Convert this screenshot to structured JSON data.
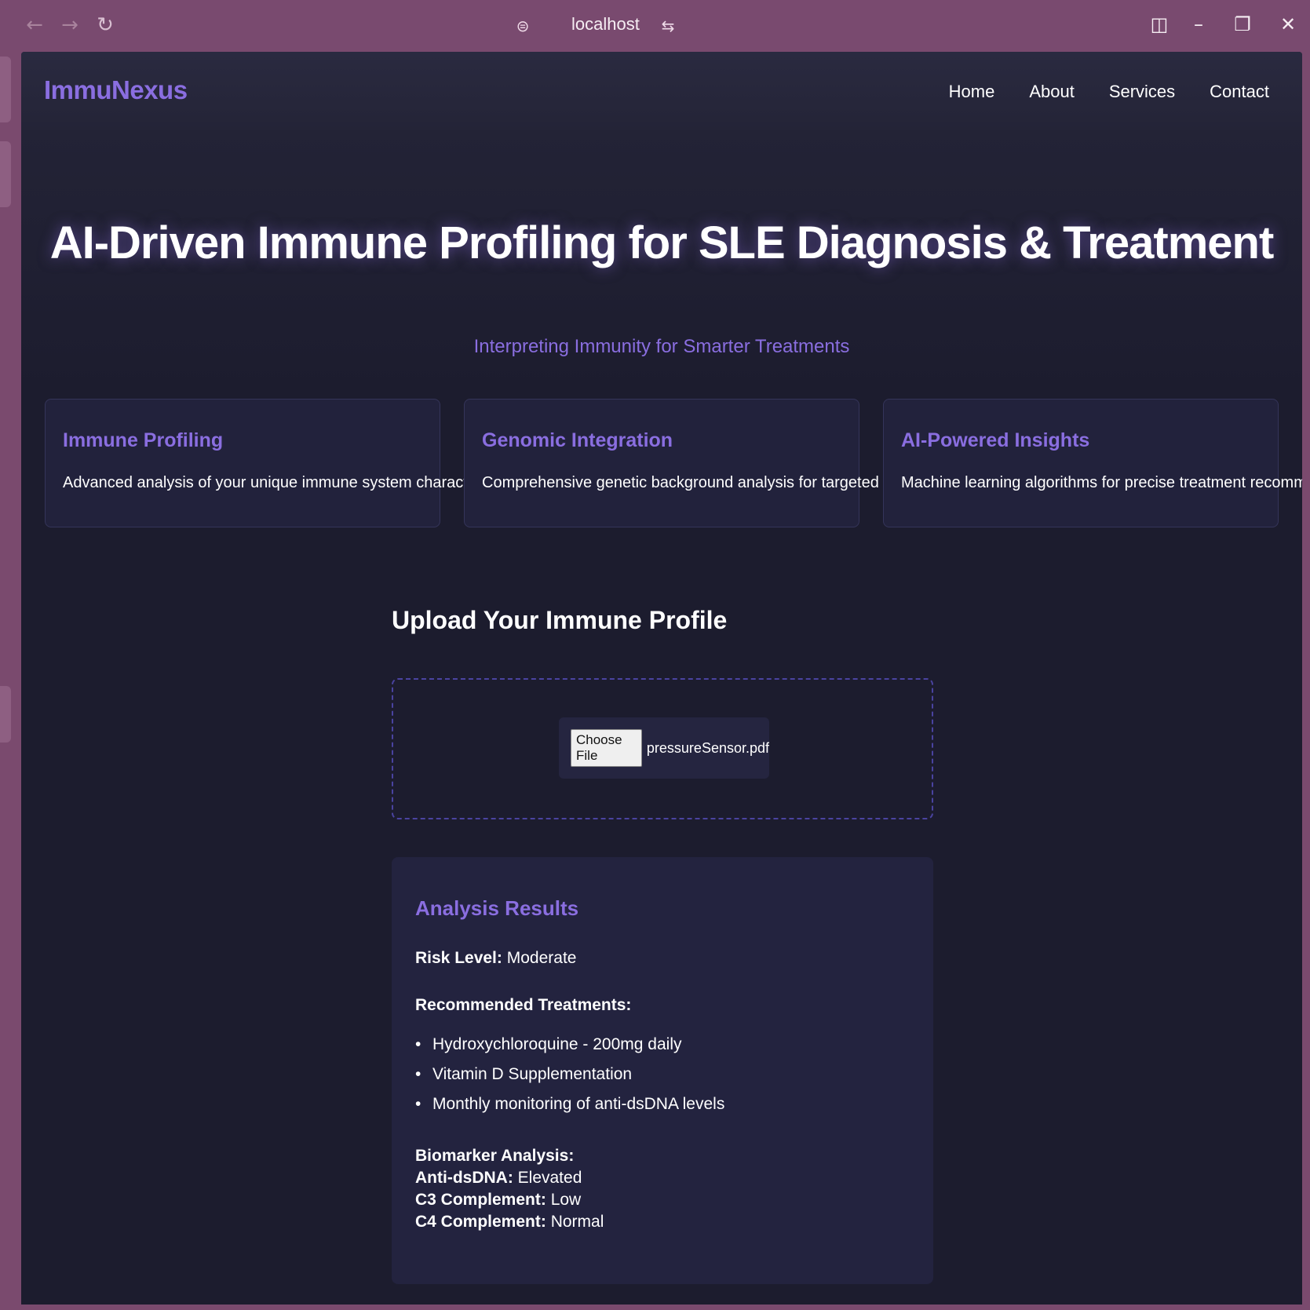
{
  "browser": {
    "url": "localhost",
    "icons": [
      "back-arrow-icon",
      "forward-arrow-icon",
      "reload-icon",
      "site-info-icon",
      "site-settings-icon",
      "sidebar-icon",
      "minimize-icon",
      "restore-icon",
      "close-icon"
    ]
  },
  "header": {
    "logo": "ImmuNexus",
    "nav": [
      "Home",
      "About",
      "Services",
      "Contact"
    ]
  },
  "hero": {
    "title": "AI-Driven Immune Profiling for SLE Diagnosis & Treatment",
    "subtitle": "Interpreting Immunity for Smarter Treatments"
  },
  "features": [
    {
      "title": "Immune Profiling",
      "desc": "Advanced analysis of your unique immune system characteristics"
    },
    {
      "title": "Genomic Integration",
      "desc": "Comprehensive genetic background analysis for targeted treatment"
    },
    {
      "title": "AI-Powered Insights",
      "desc": "Machine learning algorithms for precise treatment recommendations"
    }
  ],
  "upload": {
    "title": "Upload Your Immune Profile",
    "button": "Choose File",
    "file_name": "pressureSensor.pdf"
  },
  "results": {
    "title": "Analysis Results",
    "risk_label": "Risk Level:",
    "risk_value": "Moderate",
    "treatments_label": "Recommended Treatments:",
    "treatments": [
      "Hydroxychloroquine - 200mg daily",
      "Vitamin D Supplementation",
      "Monthly monitoring of anti-dsDNA levels"
    ],
    "biomarker_label": "Biomarker Analysis:",
    "biomarkers": [
      {
        "name": "Anti-dsDNA:",
        "value": "Elevated"
      },
      {
        "name": "C3 Complement:",
        "value": "Low"
      },
      {
        "name": "C4 Complement:",
        "value": "Normal"
      }
    ]
  },
  "colors": {
    "accent": "#8a6ee0",
    "page_bg": "#1c1c2e",
    "card_bg": "#22223c",
    "chrome_bg": "#794a6f"
  }
}
